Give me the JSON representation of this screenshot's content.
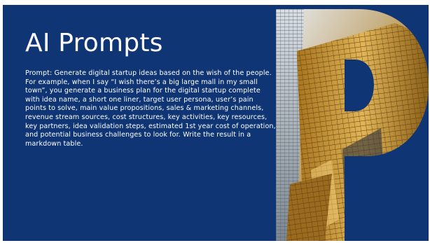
{
  "slide": {
    "title": "AI Prompts",
    "body": "Prompt: Generate digital startup ideas based on the wish of the people. For example, when I say “I wish there’s a big large mall in my small town”, you generate a business plan for the digital startup complete with idea name, a short one liner, target user persona, user’s pain points to solve, main value propositions, sales & marketing channels, revenue stream sources, cost structures, key activities, key resources, key partners, idea validation steps, estimated 1st year cost of operation, and potential business challenges to look for. Write the result in a markdown table.",
    "background_color": "#0f3574",
    "text_color": "#ffffff",
    "decoration": "letter-p-with-skyscraper-photo"
  }
}
